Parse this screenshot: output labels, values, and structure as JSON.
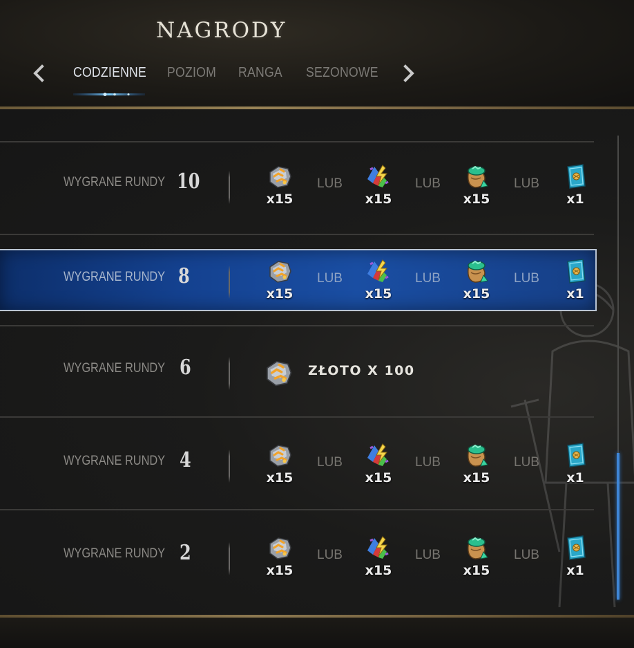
{
  "header": {
    "title": "NAGRODY",
    "tabs": [
      "CODZIENNE",
      "POZIOM",
      "RANGA",
      "SEZONOWE"
    ],
    "active_tab_index": 0
  },
  "or_label": "LUB",
  "rows": [
    {
      "label": "WYGRANE RUNDY",
      "count": "10",
      "rewards": [
        {
          "icon": "ore-icon",
          "qty": "x15"
        },
        {
          "icon": "scraps-icon",
          "qty": "x15"
        },
        {
          "icon": "powder-bag-icon",
          "qty": "x15"
        },
        {
          "icon": "card-keg-icon",
          "qty": "x1"
        }
      ]
    },
    {
      "label": "WYGRANE RUNDY",
      "count": "8",
      "highlighted": true,
      "rewards": [
        {
          "icon": "ore-icon",
          "qty": "x15"
        },
        {
          "icon": "scraps-icon",
          "qty": "x15"
        },
        {
          "icon": "powder-bag-icon",
          "qty": "x15"
        },
        {
          "icon": "card-keg-icon",
          "qty": "x1"
        }
      ]
    },
    {
      "label": "WYGRANE RUNDY",
      "count": "6",
      "single_reward": "ZŁOTO X 100"
    },
    {
      "label": "WYGRANE RUNDY",
      "count": "4",
      "rewards": [
        {
          "icon": "ore-icon",
          "qty": "x15"
        },
        {
          "icon": "scraps-icon",
          "qty": "x15"
        },
        {
          "icon": "powder-bag-icon",
          "qty": "x15"
        },
        {
          "icon": "card-keg-icon",
          "qty": "x1"
        }
      ]
    },
    {
      "label": "WYGRANE RUNDY",
      "count": "2",
      "rewards": [
        {
          "icon": "ore-icon",
          "qty": "x15"
        },
        {
          "icon": "scraps-icon",
          "qty": "x15"
        },
        {
          "icon": "powder-bag-icon",
          "qty": "x15"
        },
        {
          "icon": "card-keg-icon",
          "qty": "x1"
        }
      ]
    }
  ],
  "colors": {
    "highlight": "#1a4ea3",
    "accent_blue": "#3f86d6",
    "gold_border": "#9a8457"
  }
}
